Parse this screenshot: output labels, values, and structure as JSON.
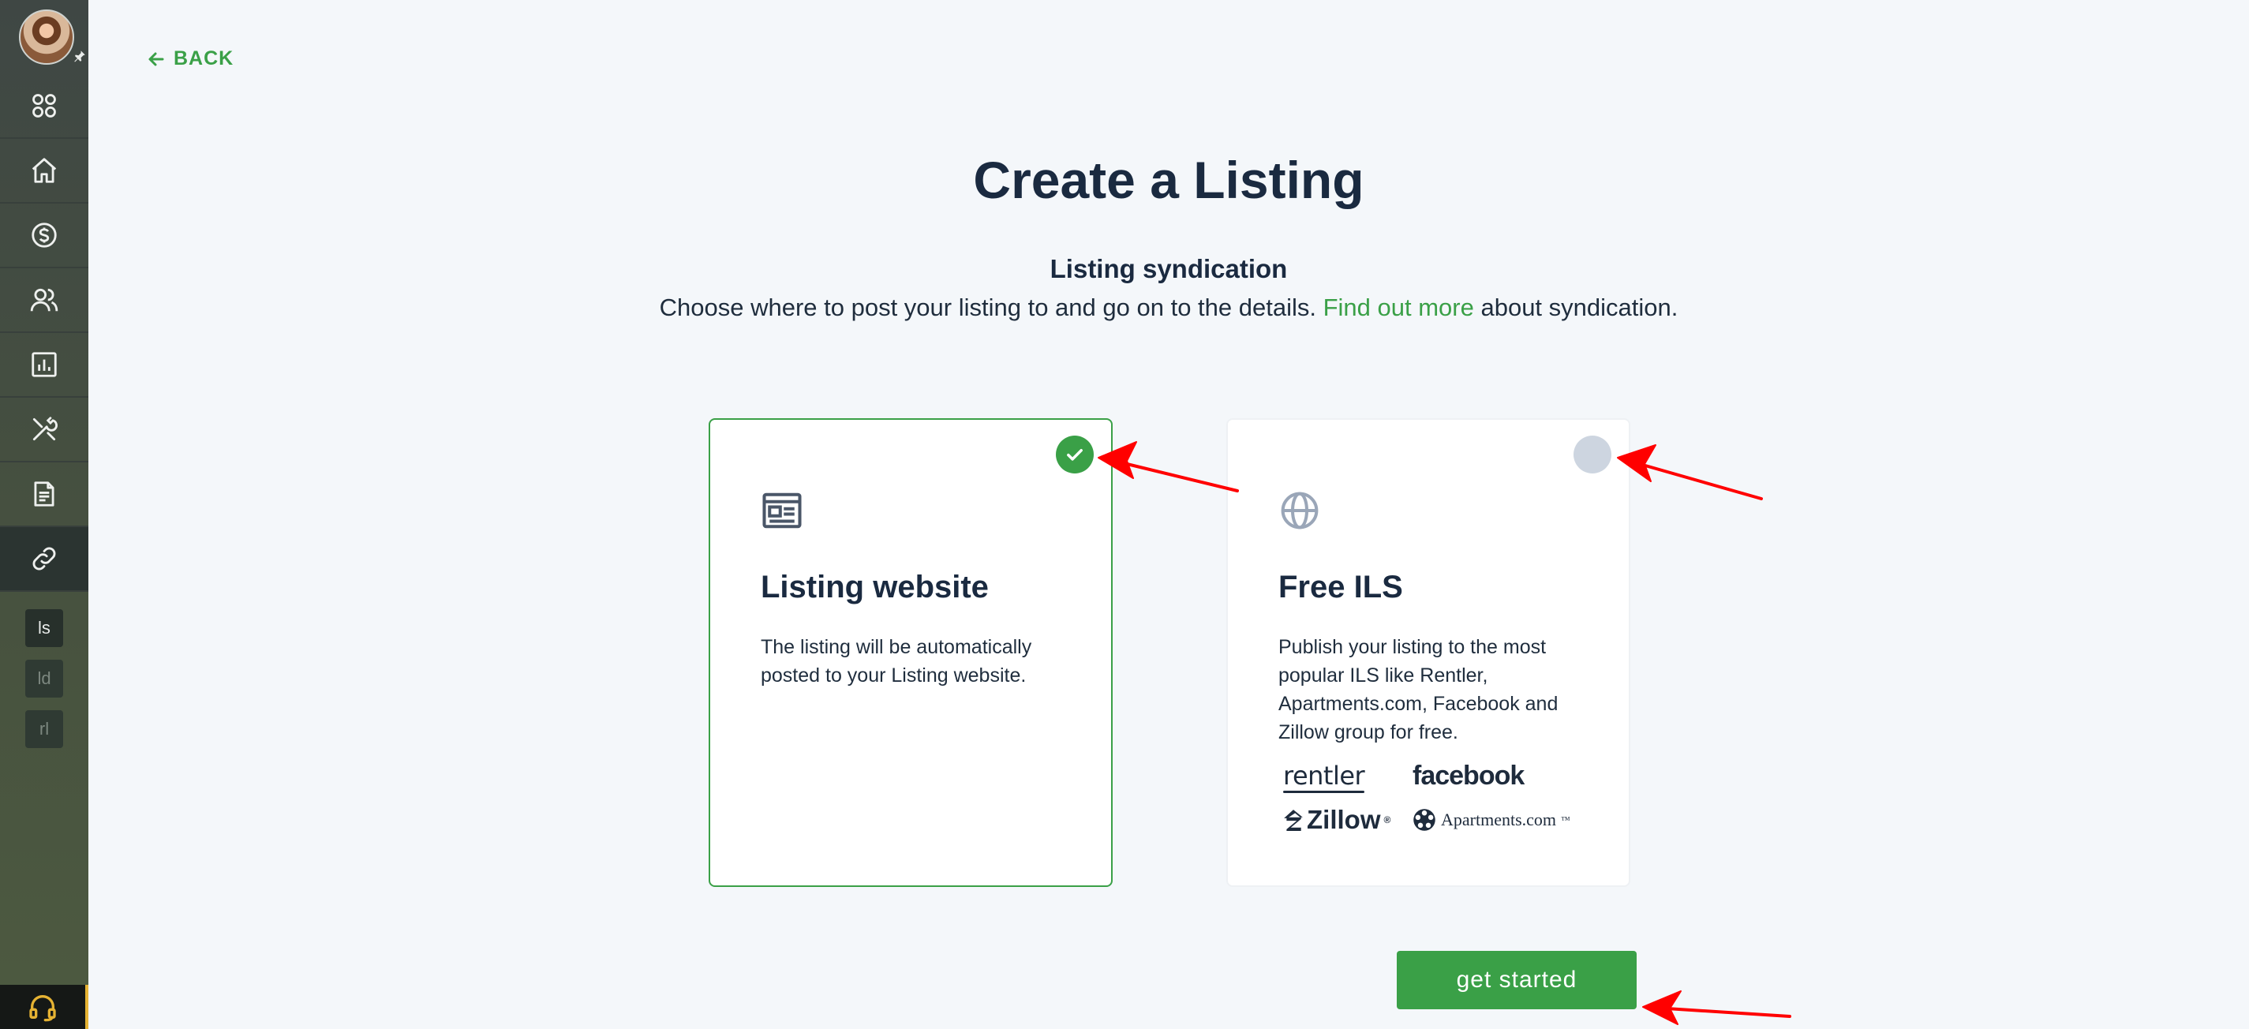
{
  "nav": {
    "back_label": "BACK",
    "mini_items": [
      "ls",
      "ld",
      "rl"
    ]
  },
  "page": {
    "title": "Create a Listing",
    "subtitle": "Listing syndication",
    "desc_before": "Choose where to post your listing to and go on to the details. ",
    "desc_link": "Find out more",
    "desc_after": " about syndication."
  },
  "cards": [
    {
      "title": "Listing website",
      "text": "The listing will be automatically posted to your Listing website.",
      "selected": true,
      "icon": "newspaper-icon"
    },
    {
      "title": "Free ILS",
      "text": "Publish your listing to the most popular ILS like Rentler, Apartments.com, Facebook and Zillow group for free.",
      "selected": false,
      "icon": "globe-icon",
      "logos": [
        "rentler",
        "facebook",
        "Zillow",
        "Apartments.com"
      ]
    }
  ],
  "cta": {
    "label": "get started"
  },
  "colors": {
    "accent": "#3aa047",
    "text": "#1a2a40",
    "sidebar": "#3f4744",
    "annotation": "#ff0000"
  }
}
